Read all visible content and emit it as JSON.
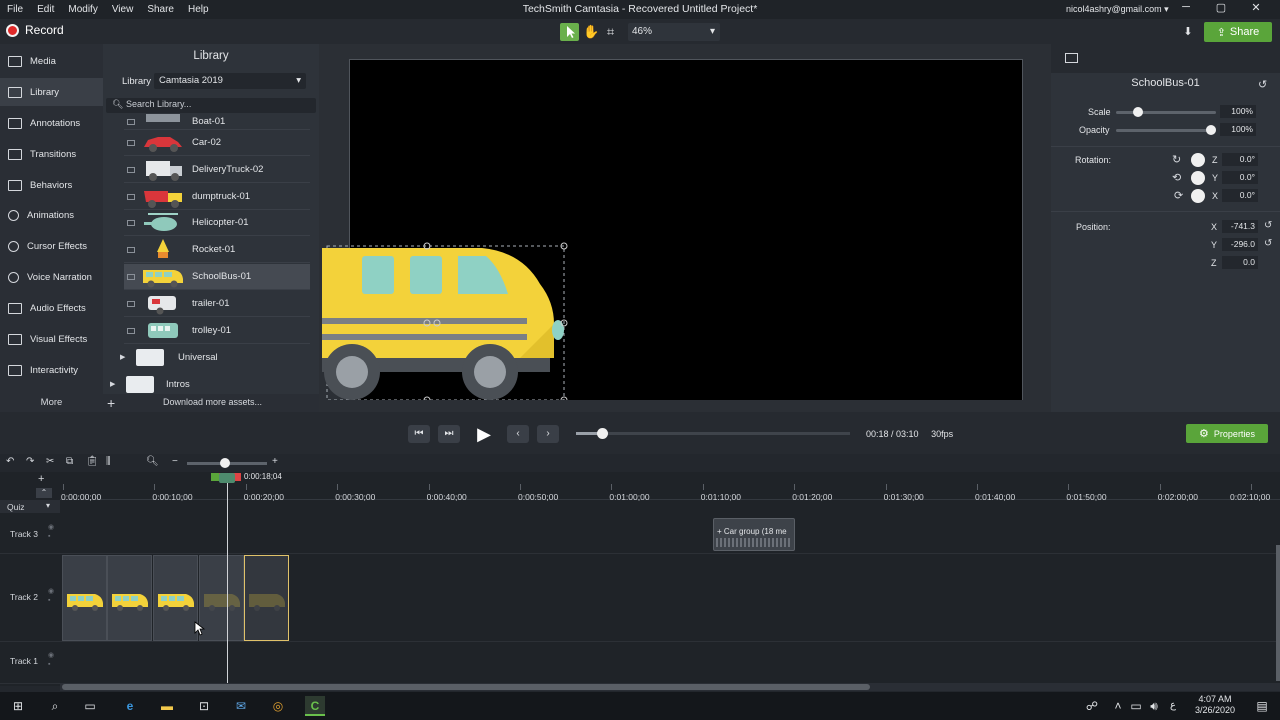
{
  "menu": {
    "items": [
      "File",
      "Edit",
      "Modify",
      "View",
      "Share",
      "Help"
    ]
  },
  "window": {
    "title": "TechSmith Camtasia - Recovered  Untitled Project*",
    "account": "nicol4ashry@gmail.com ▾",
    "minimize": "─",
    "maximize": "▢",
    "close": "✕"
  },
  "toolbar": {
    "record_label": "Record",
    "zoom": "46%",
    "share_label": "Share"
  },
  "nav": {
    "items": [
      "Media",
      "Library",
      "Annotations",
      "Transitions",
      "Behaviors",
      "Animations",
      "Cursor Effects",
      "Voice Narration",
      "Audio Effects",
      "Visual Effects",
      "Interactivity"
    ],
    "active": "Library",
    "more_label": "More"
  },
  "library": {
    "title": "Library",
    "label": "Library",
    "selected": "Camtasia 2019",
    "search_placeholder": "Search Library...",
    "items": [
      "Boat-01",
      "Car-02",
      "DeliveryTruck-02",
      "dumptruck-01",
      "Helicopter-01",
      "Rocket-01",
      "SchoolBus-01",
      "trailer-01",
      "trolley-01"
    ],
    "selected_item": "SchoolBus-01",
    "folders": [
      "Universal",
      "Intros"
    ],
    "download_label": "Download more assets..."
  },
  "properties": {
    "title": "SchoolBus-01",
    "scale_label": "Scale",
    "scale": "100%",
    "scale_fraction": 0.22,
    "opacity_label": "Opacity",
    "opacity": "100%",
    "opacity_fraction": 1.0,
    "rotation_label": "Rotation:",
    "rotation": {
      "z": "0.0°",
      "y": "0.0°",
      "x": "0.0°"
    },
    "position_label": "Position:",
    "position": {
      "x": "-741.3",
      "y": "-296.0",
      "z": "0.0"
    },
    "axis": {
      "x": "X",
      "y": "Y",
      "z": "Z"
    },
    "button_label": "Properties"
  },
  "playback": {
    "time": "00:18 / 03:10",
    "fps": "30fps",
    "progress_fraction": 0.094
  },
  "timeline": {
    "playhead_time": "0:00:18;04",
    "ticks": [
      "0:00:00;00",
      "0:00:10;00",
      "0:00:20;00",
      "0:00:30;00",
      "0:00:40;00",
      "0:00:50;00",
      "0:01:00;00",
      "0:01:10;00",
      "0:01:20;00",
      "0:01:30;00",
      "0:01:40;00",
      "0:01:50;00",
      "0:02:00;00",
      "0:02:10;00"
    ],
    "quiz_label": "Quiz",
    "tracks": [
      "Track 3",
      "Track 2",
      "Track 1"
    ],
    "car_group_label": "Car group  (18 me"
  },
  "taskbar": {
    "time": "4:07 AM",
    "date": "3/26/2020"
  },
  "colors": {
    "accent_green": "#5aa53a",
    "bus_yellow": "#f3d23a",
    "record_red": "#e02a2a"
  }
}
